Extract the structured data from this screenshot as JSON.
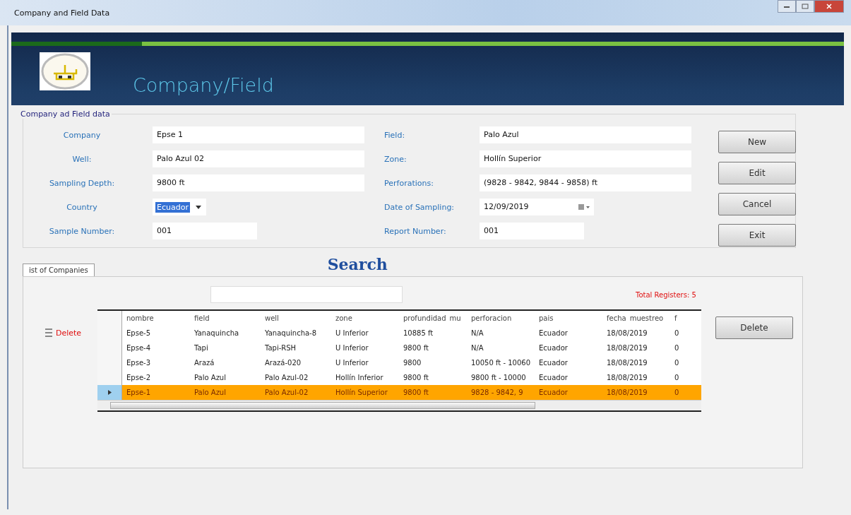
{
  "window": {
    "title": "Company and Field Data"
  },
  "header": {
    "title": "Company/Field"
  },
  "group": {
    "title": "Company ad Field data"
  },
  "fields_left": [
    {
      "label": "Company",
      "value": "Epse 1",
      "kind": "text"
    },
    {
      "label": "Well:",
      "value": "Palo Azul 02",
      "kind": "text"
    },
    {
      "label": "Sampling Depth:",
      "value": "9800 ft",
      "kind": "text"
    },
    {
      "label": "Country",
      "value": "Ecuador",
      "kind": "combo"
    },
    {
      "label": "Sample Number:",
      "value": "001",
      "kind": "short"
    }
  ],
  "fields_right": [
    {
      "label": "Field:",
      "value": "Palo Azul",
      "kind": "text"
    },
    {
      "label": "Zone:",
      "value": "Hollín Superior",
      "kind": "text"
    },
    {
      "label": "Perforations:",
      "value": "(9828 - 9842, 9844 - 9858) ft",
      "kind": "text"
    },
    {
      "label": "Date of Sampling:",
      "value": "12/09/2019",
      "kind": "date"
    },
    {
      "label": "Report Number:",
      "value": "001",
      "kind": "short"
    }
  ],
  "buttons": [
    "New",
    "Edit",
    "Cancel",
    "Exit"
  ],
  "tabs": [
    {
      "label": "ist of Companies",
      "selected": true
    }
  ],
  "search": {
    "title": "Search"
  },
  "total": "Total Registers: 5",
  "delete_label": "Delete",
  "delete_button": "Delete",
  "table": {
    "columns": [
      "nombre",
      "field",
      "well",
      "zone",
      "profundidad_mu",
      "perforacion",
      "pais",
      "fecha_muestreo",
      "f"
    ],
    "rows": [
      {
        "selected": false,
        "cells": [
          "Epse-5",
          "Yanaquincha",
          "Yanaquincha-8",
          "U Inferior",
          "10885 ft",
          "N/A",
          "Ecuador",
          "18/08/2019",
          "0"
        ]
      },
      {
        "selected": false,
        "cells": [
          "Epse-4",
          "Tapi",
          "Tapi-RSH",
          "U Inferior",
          "9800 ft",
          "N/A",
          "Ecuador",
          "18/08/2019",
          "0"
        ]
      },
      {
        "selected": false,
        "cells": [
          "Epse-3",
          "Arazá",
          "Arazá-020",
          "U Inferior",
          "9800",
          "10050 ft - 10060",
          "Ecuador",
          "18/08/2019",
          "0"
        ]
      },
      {
        "selected": false,
        "cells": [
          "Epse-2",
          "Palo Azul",
          "Palo Azul-02",
          "Hollín Inferior",
          "9800 ft",
          "9800 ft - 10000",
          "Ecuador",
          "18/08/2019",
          "0"
        ]
      },
      {
        "selected": true,
        "cells": [
          "Epse-1",
          "Palo Azul",
          "Palo Azul-02",
          "Hollín Superior",
          "9800 ft",
          "9828 - 9842, 9",
          "Ecuador",
          "18/08/2019",
          "0"
        ]
      }
    ]
  }
}
